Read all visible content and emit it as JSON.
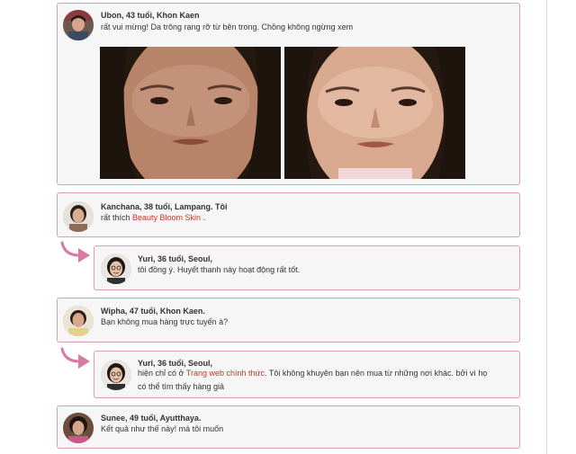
{
  "colors": {
    "accent": "#d87aa2",
    "link": "#c0392b",
    "border": "#d9a0b4"
  },
  "comments": {
    "ubon": {
      "name": "Ubon, 43 tuổi, Khon Kaen",
      "text": "rất vui mừng! Da trông rạng rỡ từ bên trong. Chồng không ngừng xem"
    },
    "kanchana": {
      "name": "Kanchana, 38 tuổi, Lampang. Tôi",
      "text_before": "rất thích ",
      "link": "Beauty Bloom Skin",
      "text_after": " ."
    },
    "yuri1": {
      "name": "Yuri, 36 tuổi, Seoul,",
      "text": "tôi đồng ý. Huyết thanh này hoạt động rất tốt."
    },
    "wipha": {
      "name": "Wipha, 47 tuổi, Khon Kaen.",
      "text": "Bạn không mua hàng trực tuyến à?"
    },
    "yuri2": {
      "name": "Yuri, 36 tuổi, Seoul,",
      "text_before": "hiện chỉ có ở ",
      "link": "Trang web chính thức",
      "text_after": ". Tôi không khuyên bạn nên mua từ những nơi khác. bởi vì họ có thể tìm thấy hàng giả"
    },
    "sunee": {
      "name": "Sunee, 49 tuổi, Ayutthaya.",
      "text": "Kết quả như thế này! mà tôi muốn"
    }
  },
  "icons": [
    "reply-arrow-icon"
  ]
}
